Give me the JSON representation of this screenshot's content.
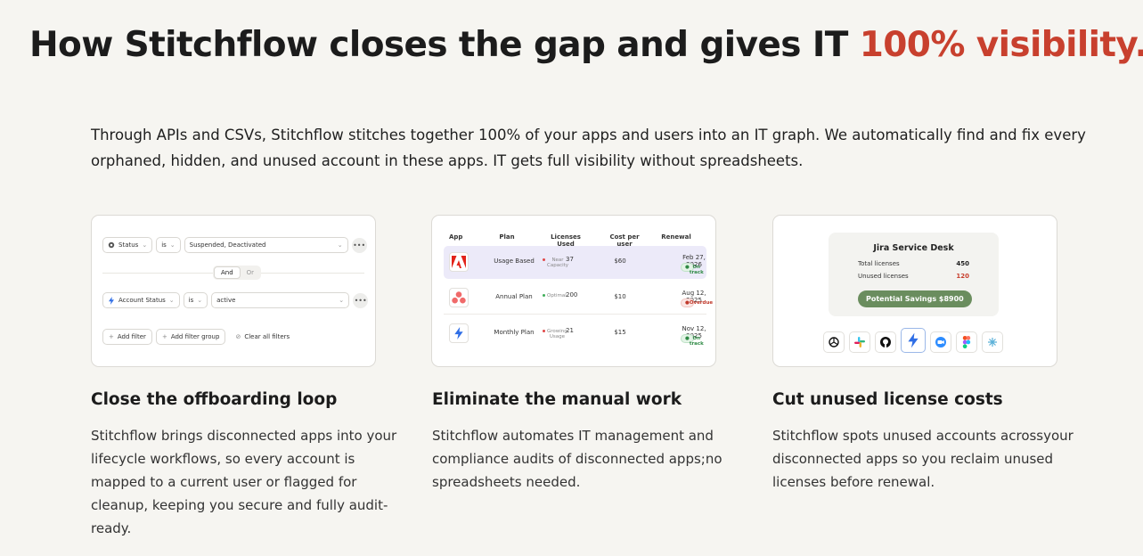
{
  "headline": {
    "main": "How Stitchflow closes the gap and gives IT ",
    "accent": "100% visibility."
  },
  "intro": "Through APIs and CSVs, Stitchflow stitches together 100% of your apps and users into an IT graph. We automatically find and fix every orphaned, hidden, and unused account in these apps. IT gets full visibility without spreadsheets.",
  "colors": {
    "accent": "#c8402e",
    "highlight_row": "#eceaf9",
    "savings_pill": "#6a8d5e"
  },
  "card1": {
    "filter1": {
      "field": "Status",
      "operator": "is",
      "value": "Suspended, Deactivated"
    },
    "connector": {
      "and": "And",
      "or": "Or"
    },
    "filter2": {
      "field": "Account Status",
      "operator": "is",
      "value": "active"
    },
    "more": "•••",
    "buttons": {
      "add_filter": "Add filter",
      "add_group": "Add filter group",
      "clear": "Clear all filters"
    }
  },
  "card2": {
    "headers": {
      "app": "App",
      "plan": "Plan",
      "licenses": "Licenses Used",
      "cost": "Cost per user",
      "renewal": "Renewal"
    },
    "rows": [
      {
        "app": "adobe-logo",
        "plan": "Usage Based",
        "licenses": "37",
        "status": "Near Capacity",
        "cost": "$60",
        "renewal": "Feb 27, 2026",
        "badge": "On track"
      },
      {
        "app": "asana-logo",
        "plan": "Annual Plan",
        "licenses": "200",
        "status": "Optimal",
        "cost": "$10",
        "renewal": "Aug 12, 2025",
        "badge": "Overdue"
      },
      {
        "app": "stitchflow-logo",
        "plan": "Monthly Plan",
        "licenses": "21",
        "status": "Growing Usage",
        "cost": "$15",
        "renewal": "Nov 12, 2025",
        "badge": "On track"
      }
    ]
  },
  "card3": {
    "title": "Jira Service Desk",
    "total_label": "Total licenses",
    "total_value": "450",
    "unused_label": "Unused licenses",
    "unused_value": "120",
    "savings": "Potential Savings $8900",
    "icons": [
      "openai-icon",
      "slack-icon",
      "github-icon",
      "bolt-icon",
      "zoom-icon",
      "figma-icon",
      "tableau-icon"
    ]
  },
  "columns": [
    {
      "title": "Close the offboarding loop",
      "desc": "Stitchflow brings disconnected apps into your lifecycle workflows, so every account is mapped to a current user or flagged for cleanup, keeping you secure and fully audit-ready."
    },
    {
      "title": "Eliminate the manual work",
      "desc": "Stitchflow automates IT management and compliance audits of disconnected apps;no spreadsheets needed."
    },
    {
      "title": "Cut unused license costs",
      "desc": "Stitchflow spots unused accounts acrossyour disconnected apps so you reclaim unused licenses before renewal."
    }
  ]
}
